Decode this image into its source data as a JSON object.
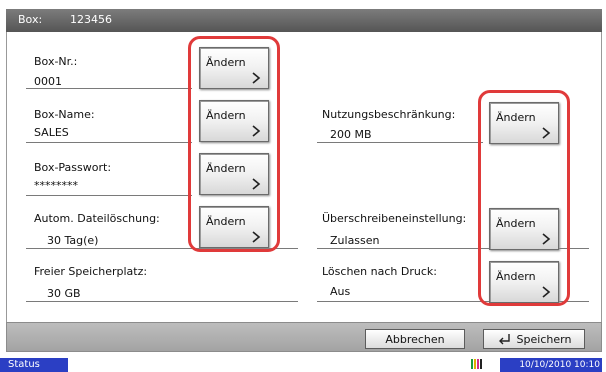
{
  "titlebar": {
    "label": "Box:",
    "value": "123456"
  },
  "fields": {
    "box_nr": {
      "label": "Box-Nr.:",
      "value": "0001"
    },
    "box_name": {
      "label": "Box-Name:",
      "value": "SALES"
    },
    "box_passwort": {
      "label": "Box-Passwort:",
      "value": "********"
    },
    "autom_dateiloeschung": {
      "label": "Autom. Dateilöschung:",
      "value": "30  Tag(e)"
    },
    "freier_speicherplatz": {
      "label": "Freier Speicherplatz:",
      "value": "30 GB"
    },
    "nutzungsbeschraenkung": {
      "label": "Nutzungsbeschränkung:",
      "value": "200 MB"
    },
    "ueberschreibeneinstellung": {
      "label": "Überschreibeneinstellung:",
      "value": "Zulassen"
    },
    "loeschen_nach_druck": {
      "label": "Löschen nach Druck:",
      "value": "Aus"
    }
  },
  "buttons": {
    "aendern": "Ändern"
  },
  "bottombar": {
    "cancel": "Abbrechen",
    "save": "Speichern"
  },
  "statusbar": {
    "status": "Status",
    "datetime": "10/10/2010  10:10"
  },
  "colors": {
    "highlight": "#e03a3a",
    "status_blue": "#2b3fc4",
    "titlebar": "#666666"
  }
}
